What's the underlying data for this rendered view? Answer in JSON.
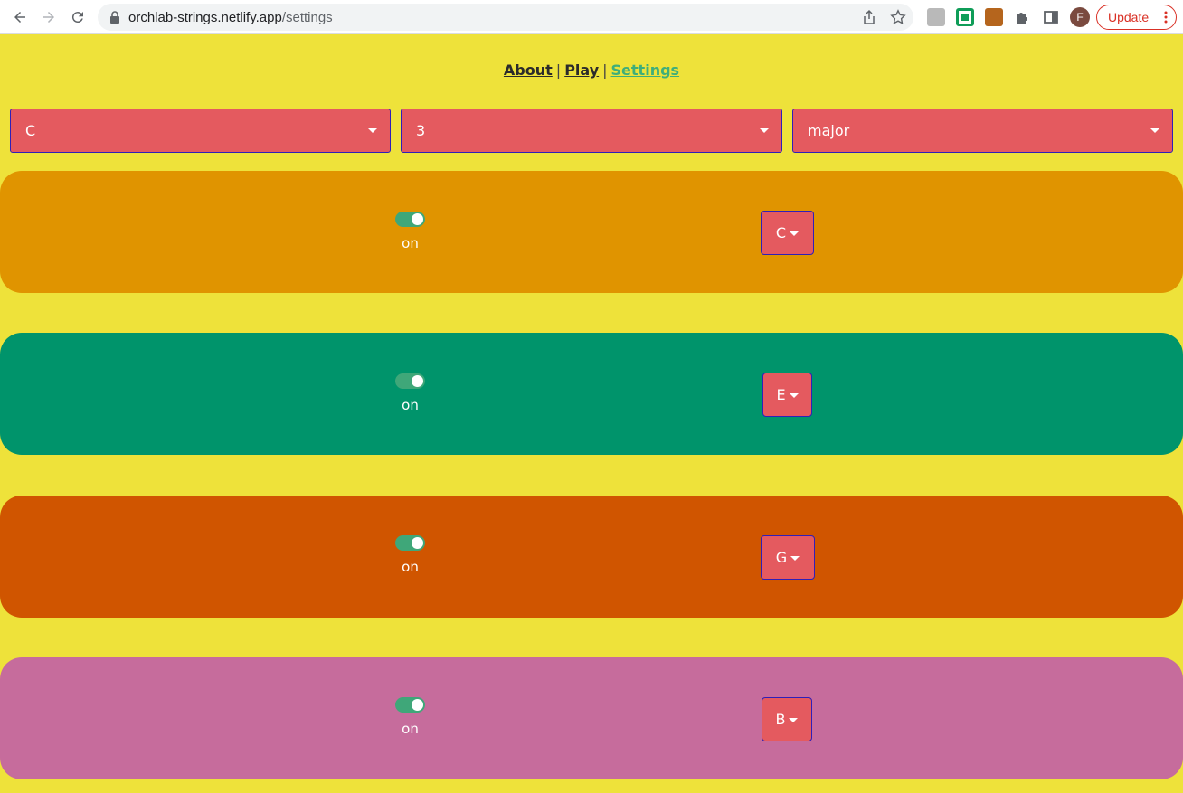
{
  "browser": {
    "url_host": "orchlab-strings.netlify.app",
    "url_path": "/settings",
    "update_label": "Update",
    "avatar_initial": "F"
  },
  "nav": {
    "about": "About",
    "play": "Play",
    "settings": "Settings",
    "separator": "|",
    "active": "Settings"
  },
  "controls": {
    "root": "C",
    "octave": "3",
    "scale": "major"
  },
  "strings": [
    {
      "enabled": true,
      "status_label": "on",
      "note": "C",
      "color": "#e09400"
    },
    {
      "enabled": true,
      "status_label": "on",
      "note": "E",
      "color": "#00946b"
    },
    {
      "enabled": true,
      "status_label": "on",
      "note": "G",
      "color": "#d05500"
    },
    {
      "enabled": true,
      "status_label": "on",
      "note": "B",
      "color": "#c66c9c"
    }
  ],
  "colors": {
    "page_bg": "#eee23a",
    "select_bg": "#e45a5f",
    "select_border": "#2f1fb8",
    "toggle_on": "#3fa779",
    "active_link": "#3fae7a"
  }
}
